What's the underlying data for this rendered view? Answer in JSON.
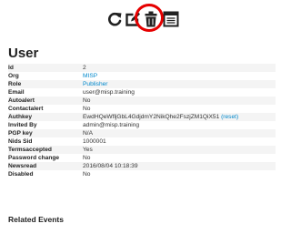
{
  "toolbar": {
    "icons": [
      "refresh-icon",
      "edit-icon",
      "delete-icon",
      "events-list-icon"
    ],
    "highlight_color": "#e60000"
  },
  "page": {
    "title": "User",
    "related_heading": "Related Events"
  },
  "fields": {
    "id": {
      "label": "Id",
      "value": "2"
    },
    "org": {
      "label": "Org",
      "value": "MISP"
    },
    "role": {
      "label": "Role",
      "value": "Publisher"
    },
    "email": {
      "label": "Email",
      "value": "user@misp.training"
    },
    "autoalert": {
      "label": "Autoalert",
      "value": "No"
    },
    "contactalert": {
      "label": "Contactalert",
      "value": "No"
    },
    "authkey": {
      "label": "Authkey",
      "value": "EwdHQeWfljGbL4GdjdmY2NikQhe2FszjZM1QiX51",
      "reset": "(reset)"
    },
    "invited_by": {
      "label": "Invited By",
      "value": "admin@misp.training"
    },
    "pgp_key": {
      "label": "PGP key",
      "value": "N/A"
    },
    "nids_sid": {
      "label": "Nids Sid",
      "value": "1000001"
    },
    "termsaccepted": {
      "label": "Termsaccepted",
      "value": "Yes"
    },
    "password_change": {
      "label": "Password change",
      "value": "No"
    },
    "newsread": {
      "label": "Newsread",
      "value": "2016/08/04 10:18:39"
    },
    "disabled": {
      "label": "Disabled",
      "value": "No"
    }
  },
  "colors": {
    "link": "#0088cc",
    "warning": "#cc0000"
  }
}
